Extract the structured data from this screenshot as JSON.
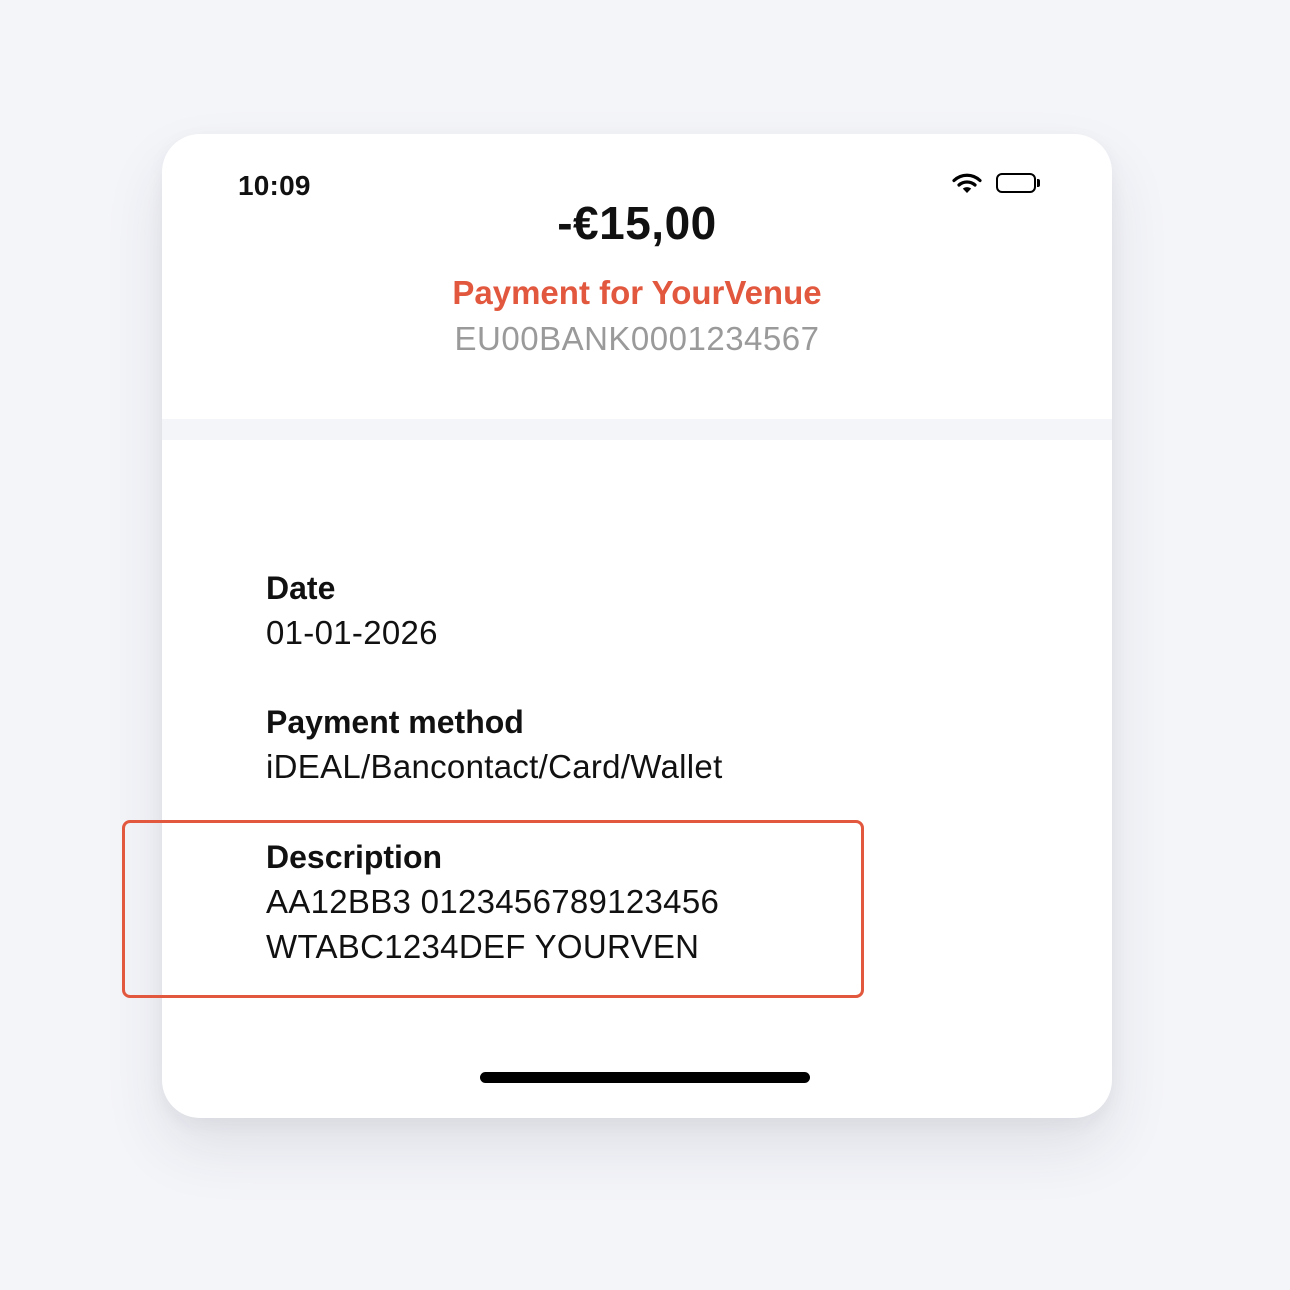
{
  "status_bar": {
    "time": "10:09",
    "wifi_icon": "wifi-icon",
    "battery_icon": "battery-icon"
  },
  "transaction": {
    "amount": "-€15,00",
    "payee": "Payment for YourVenue",
    "account": "EU00BANK0001234567"
  },
  "details": {
    "date_label": "Date",
    "date_value": "01-01-2026",
    "method_label": "Payment method",
    "method_value": "iDEAL/Bancontact/Card/Wallet",
    "description_label": "Description",
    "description_line1": "AA12BB3 0123456789123456",
    "description_line2": "WTABC1234DEF YOURVEN"
  },
  "colors": {
    "accent": "#e2583e",
    "muted_text": "#9a9a9a",
    "background": "#f4f5f9"
  }
}
